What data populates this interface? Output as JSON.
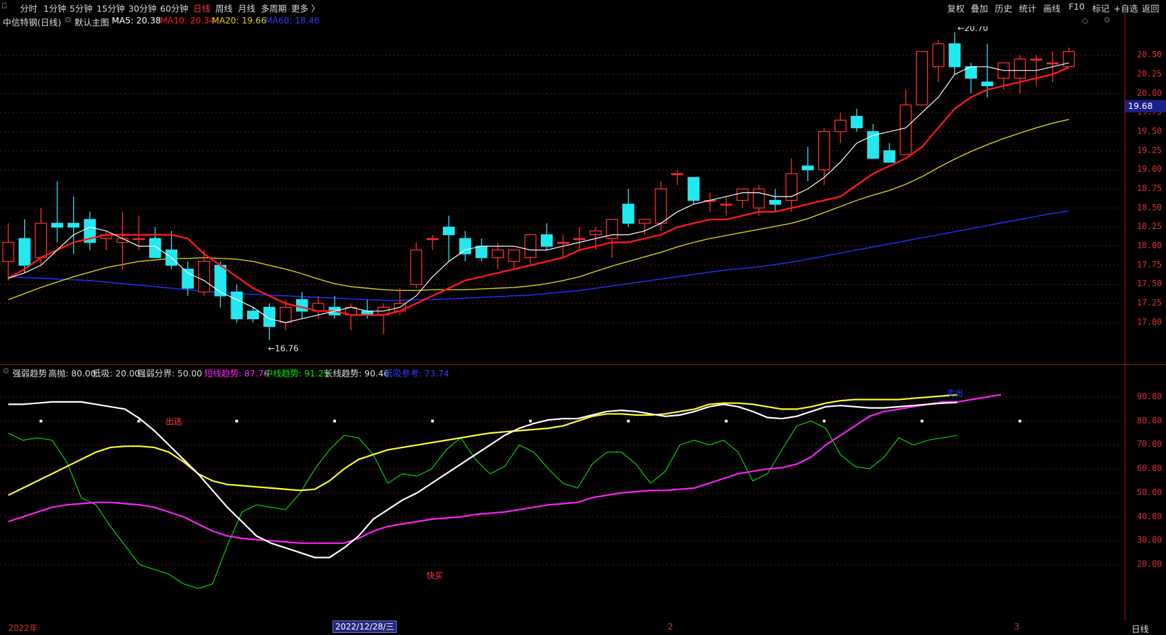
{
  "toolbar": {
    "corner": "⎕",
    "periods": [
      "分时",
      "1分钟",
      "5分钟",
      "15分钟",
      "30分钟",
      "60分钟",
      "日线",
      "周线",
      "月线",
      "多周期",
      "更多 〉"
    ],
    "active_period": "日线",
    "right_buttons": [
      "复权",
      "叠加",
      "历史",
      "统计",
      "画线",
      "F10",
      "标记",
      "+自选",
      "返回"
    ],
    "diamond": "◇",
    "small_icon": "⊙"
  },
  "title_bar": {
    "stock": "中信特钢(日线)",
    "main_indicator": "默认主图",
    "ma5": "MA5: 20.38",
    "ma10": "MA10: 20.34",
    "ma20": "MA20: 19.66",
    "ma60": "MA60: 18.46"
  },
  "price_panel": {
    "high_label": "20.70",
    "low_label": "16.76",
    "current_price": "19.68",
    "axis": [
      "20.50",
      "20.25",
      "20.00",
      "19.75",
      "19.50",
      "19.25",
      "19.00",
      "18.75",
      "18.50",
      "18.25",
      "18.00",
      "17.75",
      "17.50",
      "17.25",
      "17.00"
    ]
  },
  "indicator_header": {
    "name": "强弱趋势",
    "high": "高抛: 80.00",
    "low": "低吸: 20.00",
    "divider": "强弱分界: 50.00",
    "short": "短线趋势: 87.76",
    "mid": "中线趋势: 91.25",
    "long": "长线趋势: 90.46",
    "ref": "低吸参考: 73.74"
  },
  "indicator_panel": {
    "axis": [
      "90.00",
      "80.00",
      "70.00",
      "60.00",
      "50.00",
      "40.00",
      "30.00",
      "20.00"
    ],
    "escape_label": "出逃",
    "buy_label": "快买",
    "sell_label": "卖出"
  },
  "date_bar": {
    "year": "2022年",
    "current_date": "2022/12/28/三",
    "m2": "2",
    "m3": "3",
    "period": "日线"
  },
  "colors": {
    "up": "#ff2e2e",
    "down": "#22e8f0",
    "ma5": "#ffffff",
    "ma10": "#ff1a1a",
    "ma20": "#d7d400",
    "ma60": "#1c2ef0",
    "short": "#ff22ff",
    "mid": "#00ee00",
    "long": "#ffff22",
    "ref": "#2a3cff",
    "grid": "#7a1010"
  },
  "chart_data": {
    "type": "candlestick",
    "candles": [
      [
        17.8,
        18.3,
        17.55,
        18.05
      ],
      [
        18.1,
        18.35,
        17.65,
        17.75
      ],
      [
        17.85,
        18.5,
        17.75,
        18.3
      ],
      [
        18.3,
        18.85,
        18.05,
        18.25
      ],
      [
        18.3,
        18.65,
        17.9,
        18.25
      ],
      [
        18.35,
        18.45,
        17.95,
        18.05
      ],
      [
        18.1,
        18.2,
        17.95,
        18.15
      ],
      [
        18.05,
        18.45,
        17.7,
        18.1
      ],
      [
        18.1,
        18.4,
        17.95,
        18.1
      ],
      [
        18.1,
        18.25,
        17.85,
        17.85
      ],
      [
        17.95,
        18.2,
        17.7,
        17.75
      ],
      [
        17.7,
        17.8,
        17.35,
        17.45
      ],
      [
        17.4,
        17.95,
        17.35,
        17.8
      ],
      [
        17.75,
        17.8,
        17.2,
        17.35
      ],
      [
        17.4,
        17.5,
        17.0,
        17.05
      ],
      [
        17.15,
        17.2,
        17.0,
        17.05
      ],
      [
        17.2,
        17.25,
        16.77,
        16.95
      ],
      [
        17.0,
        17.3,
        16.9,
        17.2
      ],
      [
        17.3,
        17.4,
        17.05,
        17.15
      ],
      [
        17.15,
        17.35,
        17.05,
        17.25
      ],
      [
        17.2,
        17.35,
        17.05,
        17.1
      ],
      [
        17.1,
        17.25,
        16.9,
        17.2
      ],
      [
        17.15,
        17.3,
        17.05,
        17.1
      ],
      [
        17.1,
        17.25,
        16.85,
        17.2
      ],
      [
        17.15,
        17.45,
        17.1,
        17.25
      ],
      [
        17.5,
        18.05,
        17.45,
        17.95
      ],
      [
        18.1,
        18.15,
        17.95,
        18.1
      ],
      [
        18.25,
        18.4,
        17.8,
        18.15
      ],
      [
        18.1,
        18.2,
        17.8,
        17.9
      ],
      [
        18.0,
        18.1,
        17.8,
        17.85
      ],
      [
        17.85,
        18.05,
        17.7,
        17.95
      ],
      [
        17.8,
        17.95,
        17.7,
        17.95
      ],
      [
        17.85,
        18.15,
        17.75,
        18.15
      ],
      [
        18.15,
        18.3,
        17.95,
        18.0
      ],
      [
        18.05,
        18.15,
        17.85,
        18.05
      ],
      [
        18.1,
        18.25,
        17.95,
        18.1
      ],
      [
        18.15,
        18.25,
        17.95,
        18.2
      ],
      [
        18.1,
        18.35,
        17.85,
        18.35
      ],
      [
        18.55,
        18.75,
        18.25,
        18.3
      ],
      [
        18.3,
        18.35,
        18.15,
        18.35
      ],
      [
        18.3,
        18.85,
        18.2,
        18.75
      ],
      [
        18.95,
        19.0,
        18.8,
        18.95
      ],
      [
        18.9,
        18.9,
        18.55,
        18.6
      ],
      [
        18.6,
        18.7,
        18.45,
        18.6
      ],
      [
        18.55,
        18.65,
        18.4,
        18.55
      ],
      [
        18.6,
        18.75,
        18.5,
        18.75
      ],
      [
        18.5,
        18.8,
        18.4,
        18.75
      ],
      [
        18.6,
        18.75,
        18.45,
        18.55
      ],
      [
        18.6,
        19.15,
        18.45,
        18.95
      ],
      [
        19.05,
        19.3,
        18.85,
        19.0
      ],
      [
        19.0,
        19.55,
        18.8,
        19.5
      ],
      [
        19.5,
        19.75,
        19.35,
        19.65
      ],
      [
        19.7,
        19.8,
        19.5,
        19.55
      ],
      [
        19.5,
        19.6,
        19.2,
        19.15
      ],
      [
        19.25,
        19.35,
        19.1,
        19.1
      ],
      [
        19.2,
        20.05,
        19.2,
        19.85
      ],
      [
        19.85,
        20.55,
        19.9,
        20.55
      ],
      [
        20.35,
        20.7,
        20.15,
        20.65
      ],
      [
        20.65,
        20.8,
        20.25,
        20.35
      ],
      [
        20.35,
        20.4,
        20.0,
        20.2
      ],
      [
        20.15,
        20.65,
        19.95,
        20.1
      ],
      [
        20.2,
        20.4,
        20.05,
        20.4
      ],
      [
        20.2,
        20.5,
        20.0,
        20.45
      ],
      [
        20.45,
        20.5,
        20.1,
        20.45
      ],
      [
        20.4,
        20.55,
        20.15,
        20.4
      ],
      [
        20.35,
        20.6,
        20.35,
        20.55
      ]
    ],
    "ma5": [
      17.58,
      17.65,
      17.75,
      17.95,
      18.15,
      18.25,
      18.2,
      18.1,
      18.0,
      18.0,
      17.85,
      17.65,
      17.55,
      17.4,
      17.3,
      17.2,
      17.05,
      17.0,
      17.05,
      17.1,
      17.15,
      17.2,
      17.15,
      17.15,
      17.2,
      17.35,
      17.6,
      17.8,
      17.95,
      18.0,
      18.0,
      18.0,
      17.95,
      17.95,
      18.0,
      18.05,
      18.1,
      18.15,
      18.15,
      18.2,
      18.3,
      18.45,
      18.55,
      18.6,
      18.65,
      18.7,
      18.7,
      18.65,
      18.65,
      18.75,
      18.9,
      19.1,
      19.35,
      19.45,
      19.5,
      19.55,
      19.75,
      19.95,
      20.25,
      20.35,
      20.35,
      20.3,
      20.3,
      20.3,
      20.35,
      20.4
    ],
    "ma10": [
      17.58,
      17.7,
      17.85,
      17.95,
      18.05,
      18.1,
      18.15,
      18.15,
      18.15,
      18.15,
      18.15,
      18.1,
      17.9,
      17.75,
      17.6,
      17.45,
      17.35,
      17.25,
      17.2,
      17.15,
      17.15,
      17.1,
      17.1,
      17.1,
      17.15,
      17.25,
      17.35,
      17.45,
      17.55,
      17.6,
      17.65,
      17.7,
      17.75,
      17.8,
      17.85,
      17.95,
      18.0,
      18.05,
      18.05,
      18.1,
      18.15,
      18.25,
      18.3,
      18.35,
      18.35,
      18.4,
      18.45,
      18.45,
      18.5,
      18.55,
      18.6,
      18.65,
      18.8,
      18.95,
      19.05,
      19.15,
      19.3,
      19.55,
      19.8,
      19.95,
      20.05,
      20.1,
      20.15,
      20.2,
      20.25,
      20.34
    ],
    "ma20": [
      17.3,
      17.38,
      17.46,
      17.53,
      17.6,
      17.66,
      17.72,
      17.76,
      17.8,
      17.82,
      17.84,
      17.84,
      17.85,
      17.84,
      17.83,
      17.8,
      17.75,
      17.7,
      17.64,
      17.57,
      17.51,
      17.47,
      17.45,
      17.43,
      17.42,
      17.42,
      17.43,
      17.43,
      17.43,
      17.44,
      17.45,
      17.46,
      17.48,
      17.51,
      17.55,
      17.6,
      17.67,
      17.74,
      17.8,
      17.86,
      17.92,
      17.99,
      18.05,
      18.1,
      18.14,
      18.18,
      18.22,
      18.26,
      18.3,
      18.36,
      18.44,
      18.52,
      18.6,
      18.67,
      18.73,
      18.81,
      18.91,
      19.03,
      19.14,
      19.24,
      19.33,
      19.41,
      19.48,
      19.55,
      19.61,
      19.66
    ],
    "ma60": [
      17.6,
      17.59,
      17.58,
      17.57,
      17.56,
      17.55,
      17.53,
      17.51,
      17.49,
      17.47,
      17.45,
      17.43,
      17.41,
      17.39,
      17.38,
      17.37,
      17.36,
      17.35,
      17.34,
      17.33,
      17.32,
      17.31,
      17.3,
      17.29,
      17.29,
      17.3,
      17.3,
      17.31,
      17.32,
      17.33,
      17.34,
      17.35,
      17.36,
      17.38,
      17.4,
      17.42,
      17.45,
      17.48,
      17.51,
      17.54,
      17.57,
      17.6,
      17.63,
      17.66,
      17.69,
      17.71,
      17.73,
      17.76,
      17.79,
      17.83,
      17.87,
      17.91,
      17.95,
      17.99,
      18.03,
      18.07,
      18.11,
      18.15,
      18.19,
      18.23,
      18.27,
      18.31,
      18.35,
      18.39,
      18.43,
      18.46
    ],
    "short_trend": [
      38,
      40,
      42,
      44,
      45,
      45.5,
      46,
      46,
      45.5,
      45,
      44,
      42,
      40,
      37,
      34,
      32,
      31,
      30.5,
      30,
      29.5,
      29,
      29,
      29,
      29,
      31,
      34,
      36,
      37,
      38,
      39,
      39.5,
      40,
      41,
      41.5,
      42,
      43,
      44,
      45,
      45.5,
      46,
      48,
      49,
      50,
      50.5,
      51,
      51,
      51.5,
      52,
      54,
      56,
      58,
      59,
      60,
      60.5,
      62,
      65,
      70,
      74,
      78,
      82,
      84,
      85,
      86,
      87,
      88,
      88,
      89,
      90,
      91
    ],
    "mid_trend": [
      75,
      72,
      73,
      72,
      63,
      48,
      45,
      36,
      28,
      20,
      18,
      16,
      12,
      10,
      12,
      28,
      42,
      45,
      44,
      43,
      50,
      60,
      68,
      74,
      73,
      66,
      54,
      58,
      57,
      60,
      68,
      73,
      64,
      58,
      61,
      70,
      67,
      60,
      54,
      52,
      62,
      67,
      67,
      62,
      54,
      59,
      70,
      72,
      70,
      72,
      67,
      55,
      58,
      68,
      78,
      80,
      77,
      66,
      61,
      60,
      65,
      73,
      70,
      72,
      73,
      74
    ],
    "long_trend": [
      49,
      52,
      55,
      58,
      61,
      64,
      67,
      69,
      69.5,
      69.5,
      69,
      67,
      63,
      58,
      55,
      53.5,
      53,
      52.5,
      52,
      51.5,
      51,
      51.5,
      55,
      60,
      64,
      66,
      68,
      69,
      70,
      71,
      72,
      73,
      74,
      75,
      75.5,
      76,
      76.5,
      77,
      78,
      80,
      82,
      83,
      83,
      82.5,
      82.5,
      83,
      84,
      85,
      87,
      87.5,
      87.5,
      87,
      86,
      85,
      85,
      86,
      87.5,
      88.5,
      89,
      89,
      89,
      89,
      89.5,
      90,
      90.5,
      91
    ],
    "ref_trend": [
      87,
      87,
      87.5,
      88,
      88,
      88,
      87,
      86,
      85,
      81,
      76,
      70,
      64,
      58,
      51,
      44,
      38,
      32,
      29,
      27,
      25,
      23,
      23,
      27,
      32,
      39,
      43,
      47,
      50,
      54,
      58,
      62,
      66,
      70,
      74,
      77,
      79,
      80.5,
      81,
      81,
      82.5,
      84,
      84.5,
      84,
      83,
      82,
      82.5,
      84,
      86,
      87,
      86,
      84,
      81.5,
      81,
      82,
      84,
      86,
      86.5,
      86,
      85.5,
      85.5,
      86,
      86.5,
      87,
      87.5,
      87.76
    ],
    "y_axis_price": [
      16.8,
      20.7
    ],
    "y_axis_indicator": [
      20,
      90
    ]
  }
}
